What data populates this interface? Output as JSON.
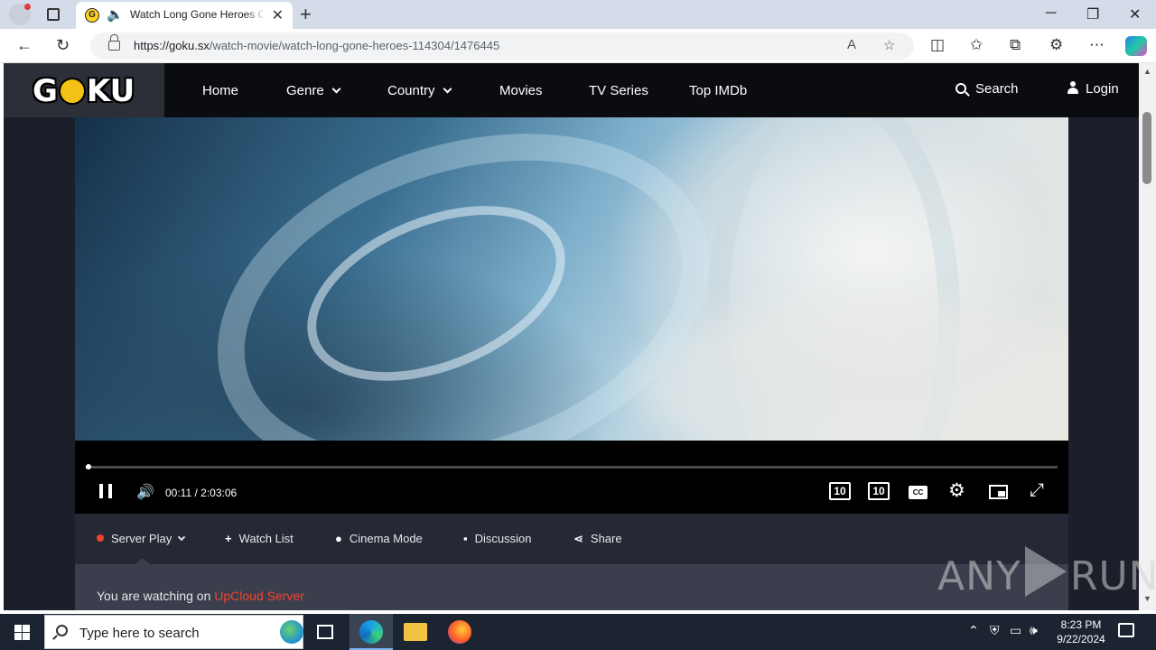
{
  "browser": {
    "tab_title": "Watch Long Gone Heroes Online",
    "tab_close": "✕",
    "new_tab": "+",
    "url_domain": "https://goku.sx",
    "url_path": "/watch-movie/watch-long-gone-heroes-114304/1476445",
    "window_controls": {
      "minimize": "─",
      "restore": "❐",
      "close": "✕"
    },
    "icons": [
      "back-icon",
      "refresh-icon",
      "read-aloud-icon",
      "favorite-star-icon",
      "split-screen-icon",
      "favorites-icon",
      "collections-icon",
      "extensions-icon",
      "more-icon",
      "copilot-icon"
    ]
  },
  "site": {
    "logo": {
      "g": "G",
      "rest": "KU"
    },
    "nav": [
      {
        "label": "Home",
        "dropdown": false
      },
      {
        "label": "Genre",
        "dropdown": true
      },
      {
        "label": "Country",
        "dropdown": true
      },
      {
        "label": "Movies",
        "dropdown": false
      },
      {
        "label": "TV Series",
        "dropdown": false
      },
      {
        "label": "Top IMDb",
        "dropdown": false
      }
    ],
    "search_label": "Search",
    "login_label": "Login"
  },
  "player": {
    "current_time": "00:11",
    "separator": "/",
    "duration": "2:03:06",
    "progress_fraction": 0.0015,
    "rewind_label": "10",
    "forward_label": "10",
    "cc_label": "CC"
  },
  "actions": {
    "server_play": "Server Play",
    "watch_list": "Watch List",
    "cinema_mode": "Cinema Mode",
    "discussion": "Discussion",
    "share": "Share"
  },
  "info": {
    "watching_prefix": "You are watching on",
    "server_name": "UpCloud Server"
  },
  "watermark": {
    "left": "ANY",
    "right": "RUN"
  },
  "taskbar": {
    "search_placeholder": "Type here to search",
    "time": "8:23 PM",
    "date": "9/22/2024"
  },
  "colors": {
    "accent_red": "#f5442c",
    "site_bg": "#1b1f2a",
    "header_bg": "#0b0c10"
  }
}
